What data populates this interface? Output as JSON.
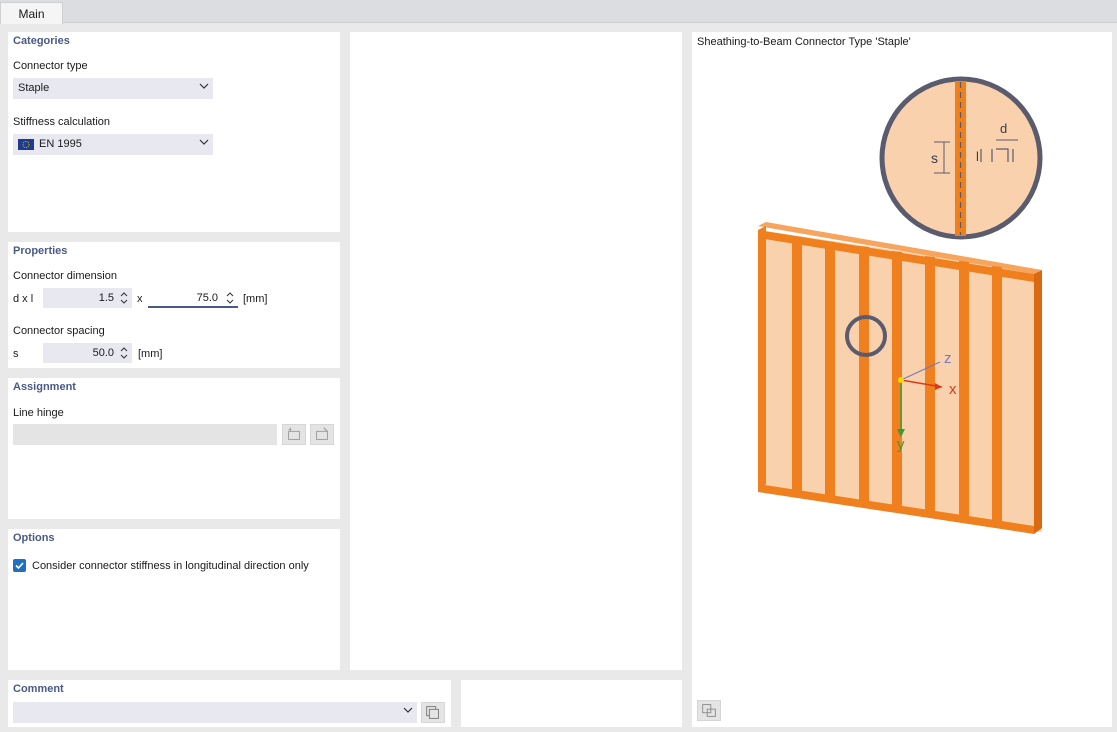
{
  "tabs": [
    {
      "label": "Main"
    }
  ],
  "categories": {
    "title": "Categories",
    "connector_type_label": "Connector type",
    "connector_type_value": "Staple",
    "stiffness_label": "Stiffness calculation",
    "stiffness_value": "EN 1995"
  },
  "properties": {
    "title": "Properties",
    "dimension_label": "Connector dimension",
    "dxl_label": "d x l",
    "d_value": "1.5",
    "x_label": "x",
    "l_value": "75.0",
    "dim_unit": "[mm]",
    "spacing_label": "Connector spacing",
    "s_label": "s",
    "s_value": "50.0",
    "spacing_unit": "[mm]"
  },
  "assignment": {
    "title": "Assignment",
    "line_hinge_label": "Line hinge",
    "line_hinge_value": ""
  },
  "options": {
    "title": "Options",
    "stiffness_only_label": "Consider connector stiffness in longitudinal direction only",
    "stiffness_only_checked": true
  },
  "comment": {
    "title": "Comment",
    "value": ""
  },
  "preview": {
    "title": "Sheathing-to-Beam Connector Type 'Staple'",
    "detail_label_s": "s",
    "detail_label_d": "d",
    "detail_label_l": "l",
    "axis_x": "x",
    "axis_y": "y",
    "axis_z": "z"
  },
  "colors": {
    "accent": "#4a5a86",
    "beam_orange": "#f07f1e",
    "sheathing": "#f9d2ad",
    "checkbox": "#1f6fc5"
  }
}
